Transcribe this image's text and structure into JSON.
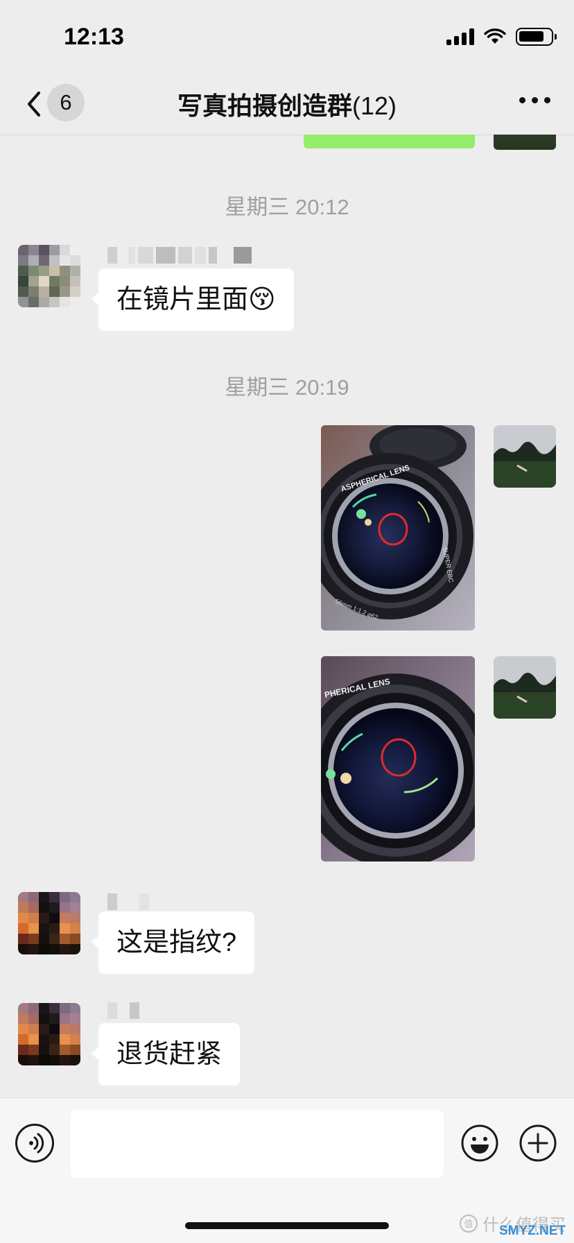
{
  "status_bar": {
    "time": "12:13",
    "battery_level": 0.8
  },
  "nav": {
    "unread_count": "6",
    "title": "写真拍摄创造群",
    "member_count": "(12)"
  },
  "messages": {
    "timestamp_1": "星期三 20:12",
    "msg_1_text": "在镜片里面😚",
    "timestamp_2": "星期三 20:19",
    "msg_2_text": "这是指纹?",
    "msg_3_text": "退货赶紧"
  },
  "photos": {
    "photo_1_lens_text": "ASPHERICAL LENS",
    "photo_1_side_text": "SUPER EBC",
    "photo_1_spec_text": "56mm 1:1.2 ⌀62",
    "photo_2_lens_text": "PHERICAL LENS"
  },
  "watermark": {
    "text": "什么值得买",
    "sub": "SMYZ.NET"
  },
  "colors": {
    "background": "#ededed",
    "sent_bubble": "#95ec69",
    "received_bubble": "#ffffff",
    "highlight_circle": "#e02b2b"
  }
}
